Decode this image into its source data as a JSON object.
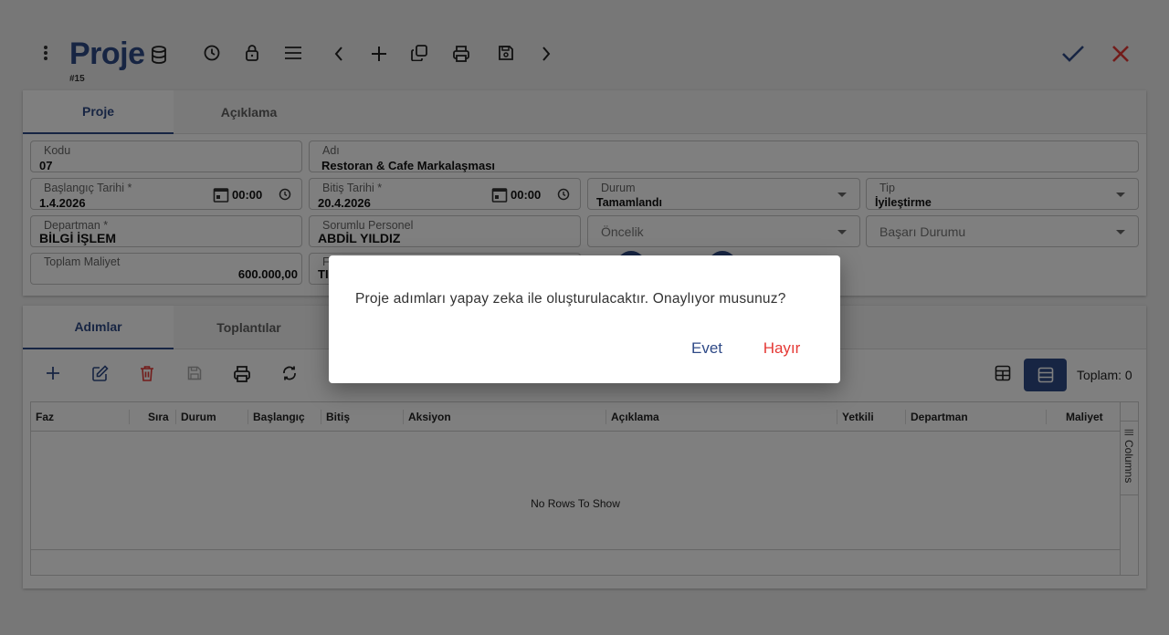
{
  "header": {
    "title": "Proje",
    "record_id": "#15"
  },
  "form_tabs": [
    {
      "label": "Proje",
      "active": true
    },
    {
      "label": "Açıklama",
      "active": false
    }
  ],
  "fields": {
    "kodu": {
      "label": "Kodu",
      "value": "07"
    },
    "adi": {
      "label": "Adı",
      "value": "Restoran & Cafe Markalaşması"
    },
    "baslangic": {
      "label": "Başlangıç Tarihi *",
      "value": "1.4.2026",
      "time": "00:00"
    },
    "bitis": {
      "label": "Bitiş Tarihi *",
      "value": "20.4.2026",
      "time": "00:00"
    },
    "durum": {
      "label": "Durum",
      "value": "Tamamlandı"
    },
    "tip": {
      "label": "Tip",
      "value": "İyileştirme"
    },
    "departman": {
      "label": "Departman *",
      "value": "BİLGİ İŞLEM"
    },
    "sorumlu": {
      "label": "Sorumlu Personel",
      "value": "ABDİL YILDIZ"
    },
    "oncelik": {
      "placeholder": "Öncelik"
    },
    "basari": {
      "placeholder": "Başarı Durumu"
    },
    "maliyet": {
      "label": "Toplam Maliyet",
      "value": "600.000,00"
    },
    "partial": {
      "label": "F",
      "value": "TI"
    }
  },
  "detail_tabs": [
    {
      "label": "Adımlar",
      "active": true
    },
    {
      "label": "Toplantılar",
      "active": false
    }
  ],
  "grid": {
    "total_label": "Toplam: 0",
    "columns": [
      "Faz",
      "Sıra",
      "Durum",
      "Başlangıç",
      "Bitiş",
      "Aksiyon",
      "Açıklama",
      "Yetkili",
      "Departman",
      "Maliyet"
    ],
    "empty_text": "No Rows To Show",
    "side_panel": "Columns"
  },
  "dialog": {
    "message": "Proje adımları yapay zeka ile oluşturulacaktır. Onaylıyor musunuz?",
    "yes": "Evet",
    "no": "Hayır"
  },
  "colors": {
    "primary": "#2f4a87",
    "danger": "#e53935",
    "overlay": "rgba(0,0,0,0.5)"
  }
}
